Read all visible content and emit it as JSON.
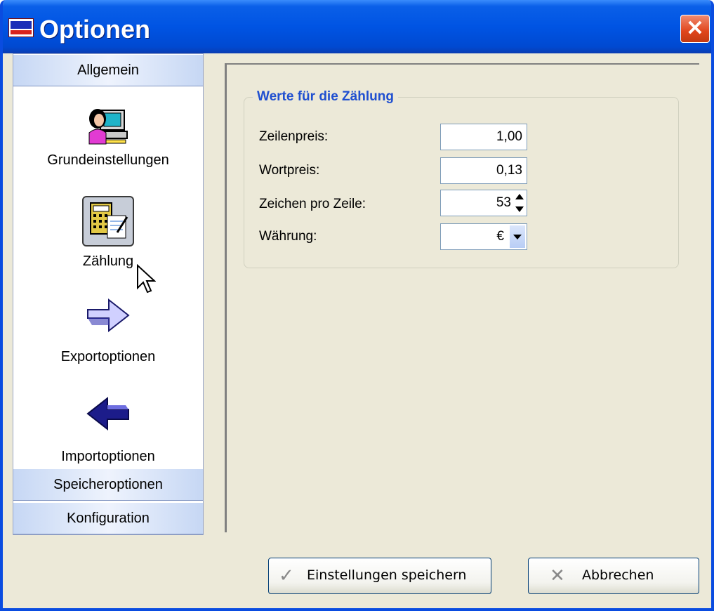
{
  "window": {
    "title": "Optionen"
  },
  "sidebar": {
    "header": "Allgemein",
    "items": [
      {
        "label": "Grundeinstellungen",
        "icon": "user-computer-icon"
      },
      {
        "label": "Zählung",
        "icon": "calculator-icon"
      },
      {
        "label": "Exportoptionen",
        "icon": "arrow-right-icon"
      },
      {
        "label": "Importoptionen",
        "icon": "arrow-left-icon"
      }
    ],
    "sections": [
      "Speicheroptionen",
      "Konfiguration"
    ]
  },
  "group": {
    "title": "Werte für die Zählung",
    "fields": [
      {
        "label": "Zeilenpreis:",
        "value": "1,00"
      },
      {
        "label": "Wortpreis:",
        "value": "0,13"
      },
      {
        "label": "Zeichen pro Zeile:",
        "value": "53"
      },
      {
        "label": "Währung:",
        "value": "€"
      }
    ]
  },
  "buttons": {
    "save": "Einstellungen speichern",
    "cancel": "Abbrechen"
  }
}
